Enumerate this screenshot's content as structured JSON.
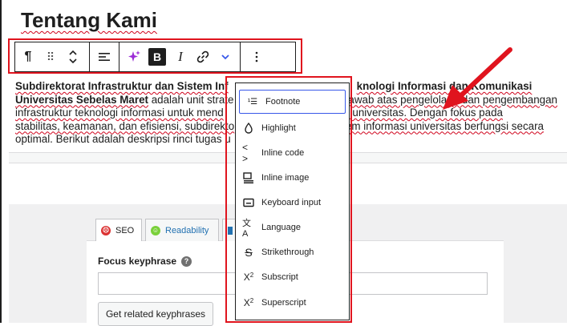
{
  "page": {
    "title": "Tentang Kami"
  },
  "toolbar": {
    "paragraph_icon": "¶",
    "drag_icon": "⠿",
    "bold_label": "B",
    "italic_label": "I"
  },
  "paragraph": {
    "bold_part": "Subdirektorat Infrastruktur dan Sistem Informasi Teknologi Informasi dan Komunikasi Universitas Sebelas Maret",
    "line1_bold_a": "Subdirektorat Infrastruktur dan Sistem Inf",
    "line1_bold_b": "knologi Informasi dan Komunikasi",
    "line2_bold": "Universitas Sebelas Maret",
    "line2_text_a": " adalah unit strate",
    "line2_text_b": "jawab atas pengelolaan dan pengembangan",
    "line3_a": "infrastruktur teknologi informasi untuk mend",
    "line3_b": "rasional universitas. Dengan fokus pada",
    "line4_a": "stabilitas, keamanan, dan efisiensi, subdirekto",
    "line4_b": "tem informasi universitas berfungsi secara",
    "line5_a": "optimal. Berikut adalah deskripsi rinci tugas u"
  },
  "yoast": {
    "tabs": [
      {
        "label": "SEO",
        "status": "bad"
      },
      {
        "label": "Readability",
        "status": "good"
      }
    ],
    "focus_keyphrase_label": "Focus keyphrase",
    "focus_keyphrase_value": "",
    "related_button": "Get related keyphrases"
  },
  "format_menu": {
    "items": [
      {
        "icon": "footnote-icon",
        "label": "Footnote",
        "focused": true
      },
      {
        "icon": "highlight-icon",
        "label": "Highlight"
      },
      {
        "icon": "inline-code-icon",
        "label": "Inline code"
      },
      {
        "icon": "inline-image-icon",
        "label": "Inline image"
      },
      {
        "icon": "keyboard-icon",
        "label": "Keyboard input"
      },
      {
        "icon": "language-icon",
        "label": "Language"
      },
      {
        "icon": "strikethrough-icon",
        "label": "Strikethrough"
      },
      {
        "icon": "subscript-icon",
        "label": "Subscript"
      },
      {
        "icon": "superscript-icon",
        "label": "Superscript"
      }
    ]
  },
  "colors": {
    "annotation_red": "#e0141e",
    "accent_blue": "#3858e9",
    "ai_purple": "#9b2bd6"
  }
}
